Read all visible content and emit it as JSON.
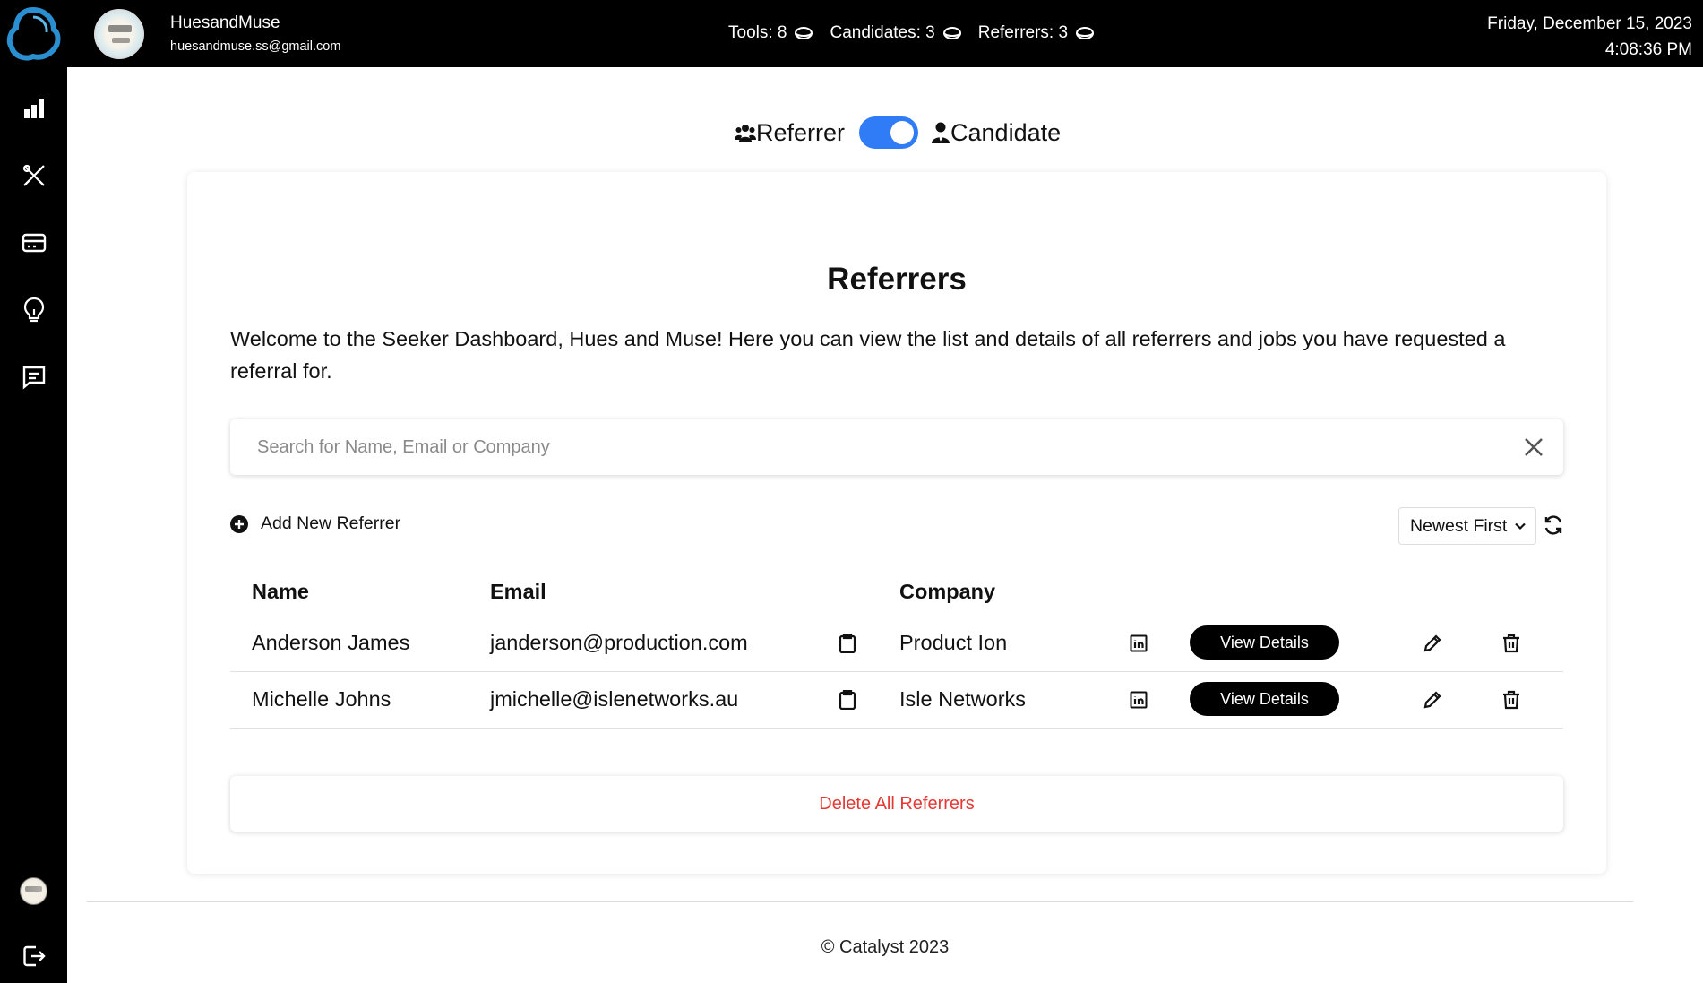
{
  "user": {
    "name": "HuesandMuse",
    "email": "huesandmuse.ss@gmail.com"
  },
  "counts": {
    "tools": "Tools: 8",
    "candidates": "Candidates: 3",
    "referrers": "Referrers: 3"
  },
  "datetime": {
    "date": "Friday, December 15, 2023",
    "time": "4:08:36 PM"
  },
  "sidebar": {
    "items": [
      {
        "icon": "bar-chart-icon"
      },
      {
        "icon": "tools-icon"
      },
      {
        "icon": "card-icon"
      },
      {
        "icon": "lightbulb-icon"
      },
      {
        "icon": "message-icon"
      }
    ],
    "bottom": [
      "avatar",
      "logout-icon"
    ]
  },
  "toggle": {
    "left_label": "Referrer",
    "right_label": "Candidate",
    "state": "candidate-side-on"
  },
  "main": {
    "title": "Referrers",
    "welcome": "Welcome to the Seeker Dashboard, Hues and Muse! Here you can view the list and details of all referrers and jobs you have requested a referral for.",
    "search_placeholder": "Search for Name, Email or Company",
    "add_label": "Add New Referrer",
    "sort_value": "Newest First"
  },
  "table": {
    "headers": {
      "name": "Name",
      "email": "Email",
      "company": "Company"
    },
    "rows": [
      {
        "name": "Anderson James",
        "email": "janderson@production.com",
        "company": "Product Ion",
        "action": "View Details"
      },
      {
        "name": "Michelle Johns",
        "email": "jmichelle@islenetworks.au",
        "company": "Isle Networks",
        "action": "View Details"
      }
    ]
  },
  "delete_all_label": "Delete All Referrers",
  "footer": "© Catalyst 2023",
  "colors": {
    "accent": "#2f7cf6",
    "danger": "#e53935",
    "bar": "#000000"
  }
}
